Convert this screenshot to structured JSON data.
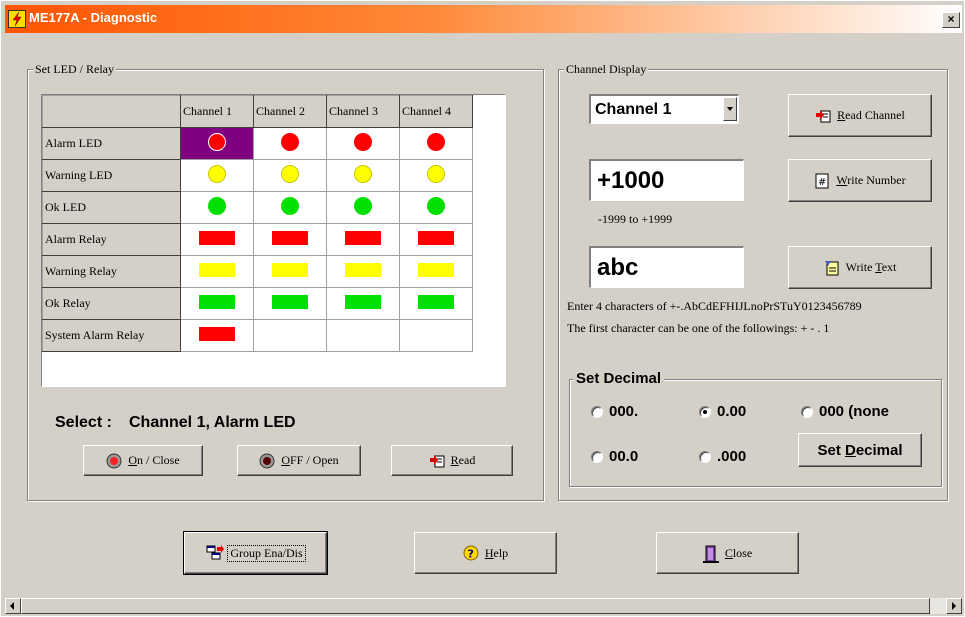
{
  "window": {
    "title": "ME177A - Diagnostic",
    "close_label": "×"
  },
  "led_group": {
    "label": "Set LED / Relay",
    "columns": [
      "Channel 1",
      "Channel 2",
      "Channel 3",
      "Channel 4"
    ],
    "rows": [
      {
        "label": "Alarm LED",
        "cells": [
          "led-red-selected",
          "led-red",
          "led-red",
          "led-red"
        ]
      },
      {
        "label": "Warning LED",
        "cells": [
          "led-yellow",
          "led-yellow",
          "led-yellow",
          "led-yellow"
        ]
      },
      {
        "label": "Ok LED",
        "cells": [
          "led-green",
          "led-green",
          "led-green",
          "led-green"
        ]
      },
      {
        "label": "Alarm Relay",
        "cells": [
          "relay-red",
          "relay-red",
          "relay-red",
          "relay-red"
        ]
      },
      {
        "label": "Warning Relay",
        "cells": [
          "relay-yellow",
          "relay-yellow",
          "relay-yellow",
          "relay-yellow"
        ]
      },
      {
        "label": "Ok Relay",
        "cells": [
          "relay-green",
          "relay-green",
          "relay-green",
          "relay-green"
        ]
      },
      {
        "label": "System Alarm Relay",
        "cells": [
          "relay-red",
          "",
          "",
          ""
        ]
      }
    ],
    "select_label": "Select :",
    "select_value": "Channel 1, Alarm LED",
    "on_button": {
      "prefix": "",
      "key": "O",
      "rest": "n / Close"
    },
    "off_button": {
      "prefix": "",
      "key": "O",
      "rest": "FF / Open"
    },
    "read_button": {
      "prefix": "",
      "key": "R",
      "rest": "ead"
    }
  },
  "channel_display": {
    "label": "Channel Display",
    "channel_select": "Channel 1",
    "number_value": "+1000",
    "number_range": "-1999 to +1999",
    "text_value": "abc",
    "text_hint_1": "Enter 4 characters of +-.AbCdEFHIJLnoPrSTuY0123456789",
    "text_hint_2": "The first character can be one of the followings: + - . 1",
    "read_channel_button": {
      "prefix": "",
      "key": "R",
      "rest": "ead Channel"
    },
    "write_number_button": {
      "prefix": "",
      "key": "W",
      "rest": "rite Number"
    },
    "write_text_button": {
      "prefix": "Write ",
      "key": "T",
      "rest": "ext"
    }
  },
  "set_decimal": {
    "label": "Set Decimal",
    "options": [
      "000.",
      "0.00",
      "000 (none",
      "00.0",
      ".000"
    ],
    "selected": "0.00",
    "button": {
      "prefix": "Set ",
      "key": "D",
      "rest": "ecimal"
    }
  },
  "bottom": {
    "group_button": "Group Ena/Dis",
    "help_button": {
      "prefix": "",
      "key": "H",
      "rest": "elp"
    },
    "close_button": {
      "prefix": "",
      "key": "C",
      "rest": "lose"
    }
  },
  "colors": {
    "title_gradient_start": "#ff5400",
    "selected_cell": "#800080",
    "red": "#ff0000",
    "yellow": "#ffff00",
    "green": "#00e000"
  }
}
